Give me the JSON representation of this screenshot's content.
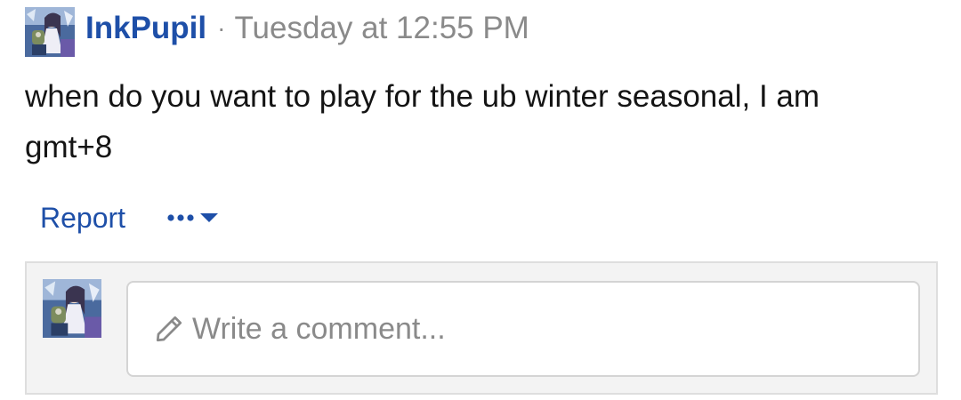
{
  "post": {
    "author": "InkPupil",
    "separator": "·",
    "timestamp": "Tuesday at 12:55 PM",
    "body": "when do you want to play for the ub winter seasonal, I am gmt+8",
    "avatar_icon": "user-avatar-anime-icon"
  },
  "actions": {
    "report_label": "Report",
    "more_icon": "ellipsis-dropdown-icon"
  },
  "comment": {
    "placeholder": "Write a comment...",
    "pencil_icon": "pencil-icon",
    "avatar_icon": "user-avatar-anime-icon"
  },
  "colors": {
    "link": "#1e4fa8",
    "muted": "#8a8a8a",
    "text": "#141414",
    "comment_bg": "#f3f3f3"
  }
}
